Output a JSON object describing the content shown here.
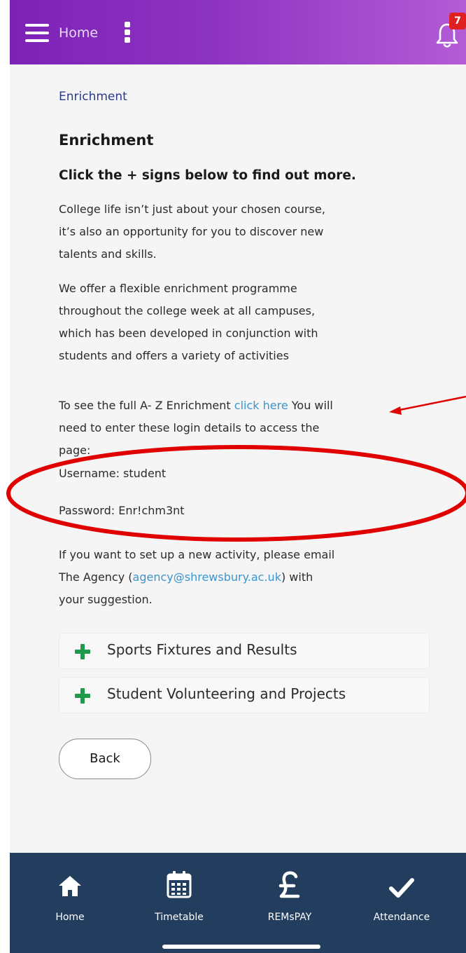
{
  "header": {
    "home_label": "Home",
    "notification_count": "7"
  },
  "breadcrumb": "Enrichment",
  "page_title": "Enrichment",
  "subtitle": "Click the + signs below to find out more.",
  "intro": {
    "line1": "College life isn’t just about your chosen course,",
    "line2": "it’s also an opportunity for you to discover new",
    "line3": "talents and skills."
  },
  "programme": {
    "line1": "We offer a flexible enrichment programme",
    "line2": "throughout the college week at all campuses,",
    "line3": "which has been developed in conjunction with",
    "line4": "students and offers a variety of activities"
  },
  "atoz": {
    "prefix": "To see the full A- Z Enrichment ",
    "link": "click here",
    "suffix": " You will",
    "line2": "need to enter these login details to access the",
    "line3": "page:"
  },
  "username": "Username: student",
  "password": "Password: Enr!chm3nt",
  "new_activity": {
    "line1": "If you want to set up a new activity, please email",
    "prefix": "The Agency (",
    "email": "agency@shrewsbury.ac.uk",
    "suffix": ") with",
    "line3": "your suggestion."
  },
  "accordions": [
    {
      "label": "Sports Fixtures and Results"
    },
    {
      "label": "Student Volunteering and Projects"
    }
  ],
  "back_label": "Back",
  "bottom_nav": [
    {
      "label": "Home",
      "icon": "home-icon"
    },
    {
      "label": "Timetable",
      "icon": "calendar-icon"
    },
    {
      "label": "REMsPAY",
      "icon": "pound-icon"
    },
    {
      "label": "Attendance",
      "icon": "checkmark-icon"
    }
  ],
  "colors": {
    "header_start": "#7d22b6",
    "header_end": "#b45bd6",
    "nav_bg": "#233d5e",
    "link": "#3b95cf",
    "plus": "#1f9a4a",
    "annotation": "#e00000"
  }
}
